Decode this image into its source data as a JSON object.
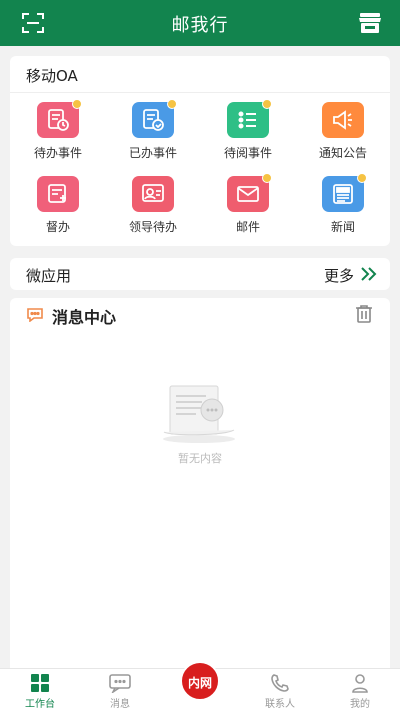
{
  "header": {
    "title": "邮我行",
    "scan_icon": "scan-icon",
    "shop_icon": "shop-icon"
  },
  "oa": {
    "title": "移动OA",
    "items": [
      {
        "label": "待办事件",
        "icon": "todo-icon",
        "color": "#f0607a",
        "badge": true
      },
      {
        "label": "已办事件",
        "icon": "done-icon",
        "color": "#4a9ae6",
        "badge": true
      },
      {
        "label": "待阅事件",
        "icon": "to-read-icon",
        "color": "#2ebf86",
        "badge": true
      },
      {
        "label": "通知公告",
        "icon": "announcement-icon",
        "color": "#ff8a3d",
        "badge": false
      },
      {
        "label": "督办",
        "icon": "supervise-icon",
        "color": "#f0607a",
        "badge": false
      },
      {
        "label": "领导待办",
        "icon": "leader-todo-icon",
        "color": "#ef5d6e",
        "badge": false
      },
      {
        "label": "邮件",
        "icon": "mail-icon",
        "color": "#ef5d6e",
        "badge": true
      },
      {
        "label": "新闻",
        "icon": "news-icon",
        "color": "#4a9ae6",
        "badge": true
      }
    ]
  },
  "micro_apps": {
    "title": "微应用",
    "more": "更多"
  },
  "messages": {
    "title": "消息中心",
    "empty_text": "暂无内容"
  },
  "tabbar": {
    "items": [
      {
        "label": "工作台",
        "icon": "workbench-icon",
        "active": true
      },
      {
        "label": "消息",
        "icon": "message-icon",
        "active": false
      },
      {
        "label": "内网",
        "icon": "intranet-button",
        "active": false
      },
      {
        "label": "联系人",
        "icon": "phone-icon",
        "active": false
      },
      {
        "label": "我的",
        "icon": "profile-icon",
        "active": false
      }
    ]
  },
  "colors": {
    "brand": "#12844e",
    "accent_red": "#d81e1e"
  }
}
